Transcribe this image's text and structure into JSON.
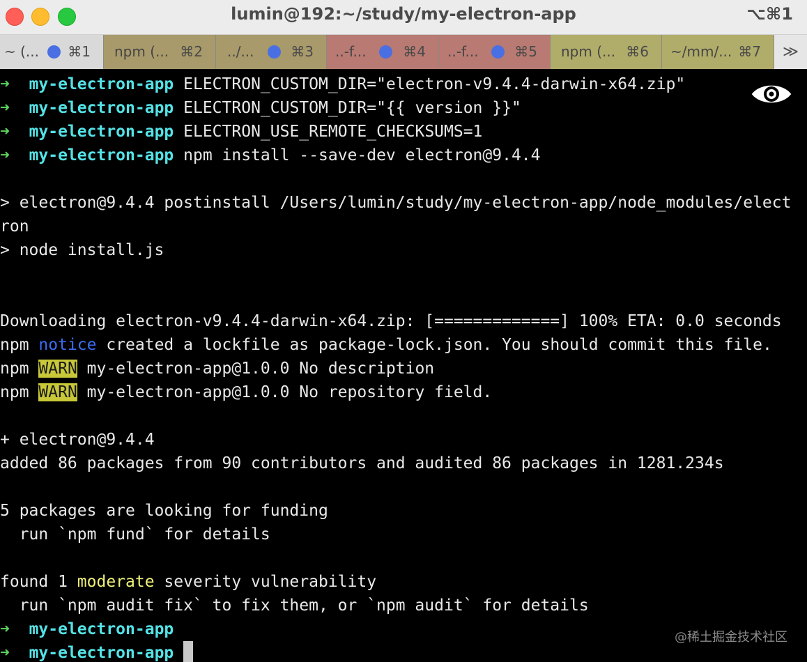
{
  "window": {
    "title": "lumin@192:~/study/my-electron-app",
    "shortcut": "⌥⌘1"
  },
  "tabs": [
    {
      "label": "~ (...",
      "key": "⌘1",
      "bg": "#d9d9d9",
      "dot": true
    },
    {
      "label": "npm (...",
      "key": "⌘2",
      "bg": "#a89a6a",
      "dot": false
    },
    {
      "label": "../...",
      "key": "⌘3",
      "bg": "#a89a6a",
      "dot": true
    },
    {
      "label": "..-f...",
      "key": "⌘4",
      "bg": "#b87a72",
      "dot": true
    },
    {
      "label": "..-f...",
      "key": "⌘5",
      "bg": "#b87a72",
      "dot": true
    },
    {
      "label": "npm (...",
      "key": "⌘6",
      "bg": "#b0ac6a",
      "dot": false
    },
    {
      "label": "~/mm/...",
      "key": "⌘7",
      "bg": "#b0ac6a",
      "dot": false
    }
  ],
  "tab_overflow": "≫",
  "prompt": {
    "arrow": "➜",
    "dir": "my-electron-app"
  },
  "commands": [
    "ELECTRON_CUSTOM_DIR=\"electron-v9.4.4-darwin-x64.zip\"",
    "ELECTRON_CUSTOM_DIR=\"{{ version }}\"",
    "ELECTRON_USE_REMOTE_CHECKSUMS=1",
    "npm install --save-dev electron@9.4.4"
  ],
  "output": {
    "postinstall_1": "> electron@9.4.4 postinstall /Users/lumin/study/my-electron-app/node_modules/elect",
    "postinstall_2": "ron",
    "node_install": "> node install.js",
    "downloading": "Downloading electron-v9.4.4-darwin-x64.zip: [=============] 100% ETA: 0.0 seconds",
    "npm": "npm",
    "notice_word": "notice",
    "notice_text": " created a lockfile as package-lock.json. You should commit this file.",
    "warn_word": "WARN",
    "warn_1": " my-electron-app@1.0.0 No description",
    "warn_2": " my-electron-app@1.0.0 No repository field.",
    "added_pkg": "+ electron@9.4.4",
    "added_summary": "added 86 packages from 90 contributors and audited 86 packages in 1281.234s",
    "funding_1": "5 packages are looking for funding",
    "funding_2": "  run `npm fund` for details",
    "found_prefix": "found 1 ",
    "moderate_word": "moderate",
    "found_suffix": " severity vulnerability",
    "audit_hint": "  run `npm audit fix` to fix them, or `npm audit` for details"
  },
  "watermark": "@稀土掘金技术社区",
  "colors": {
    "prompt_arrow": "#5fd35f",
    "prompt_dir": "#54e2e6",
    "notice": "#3b6cf0",
    "warn_bg": "#c8c838",
    "moderate": "#f0f07a"
  }
}
